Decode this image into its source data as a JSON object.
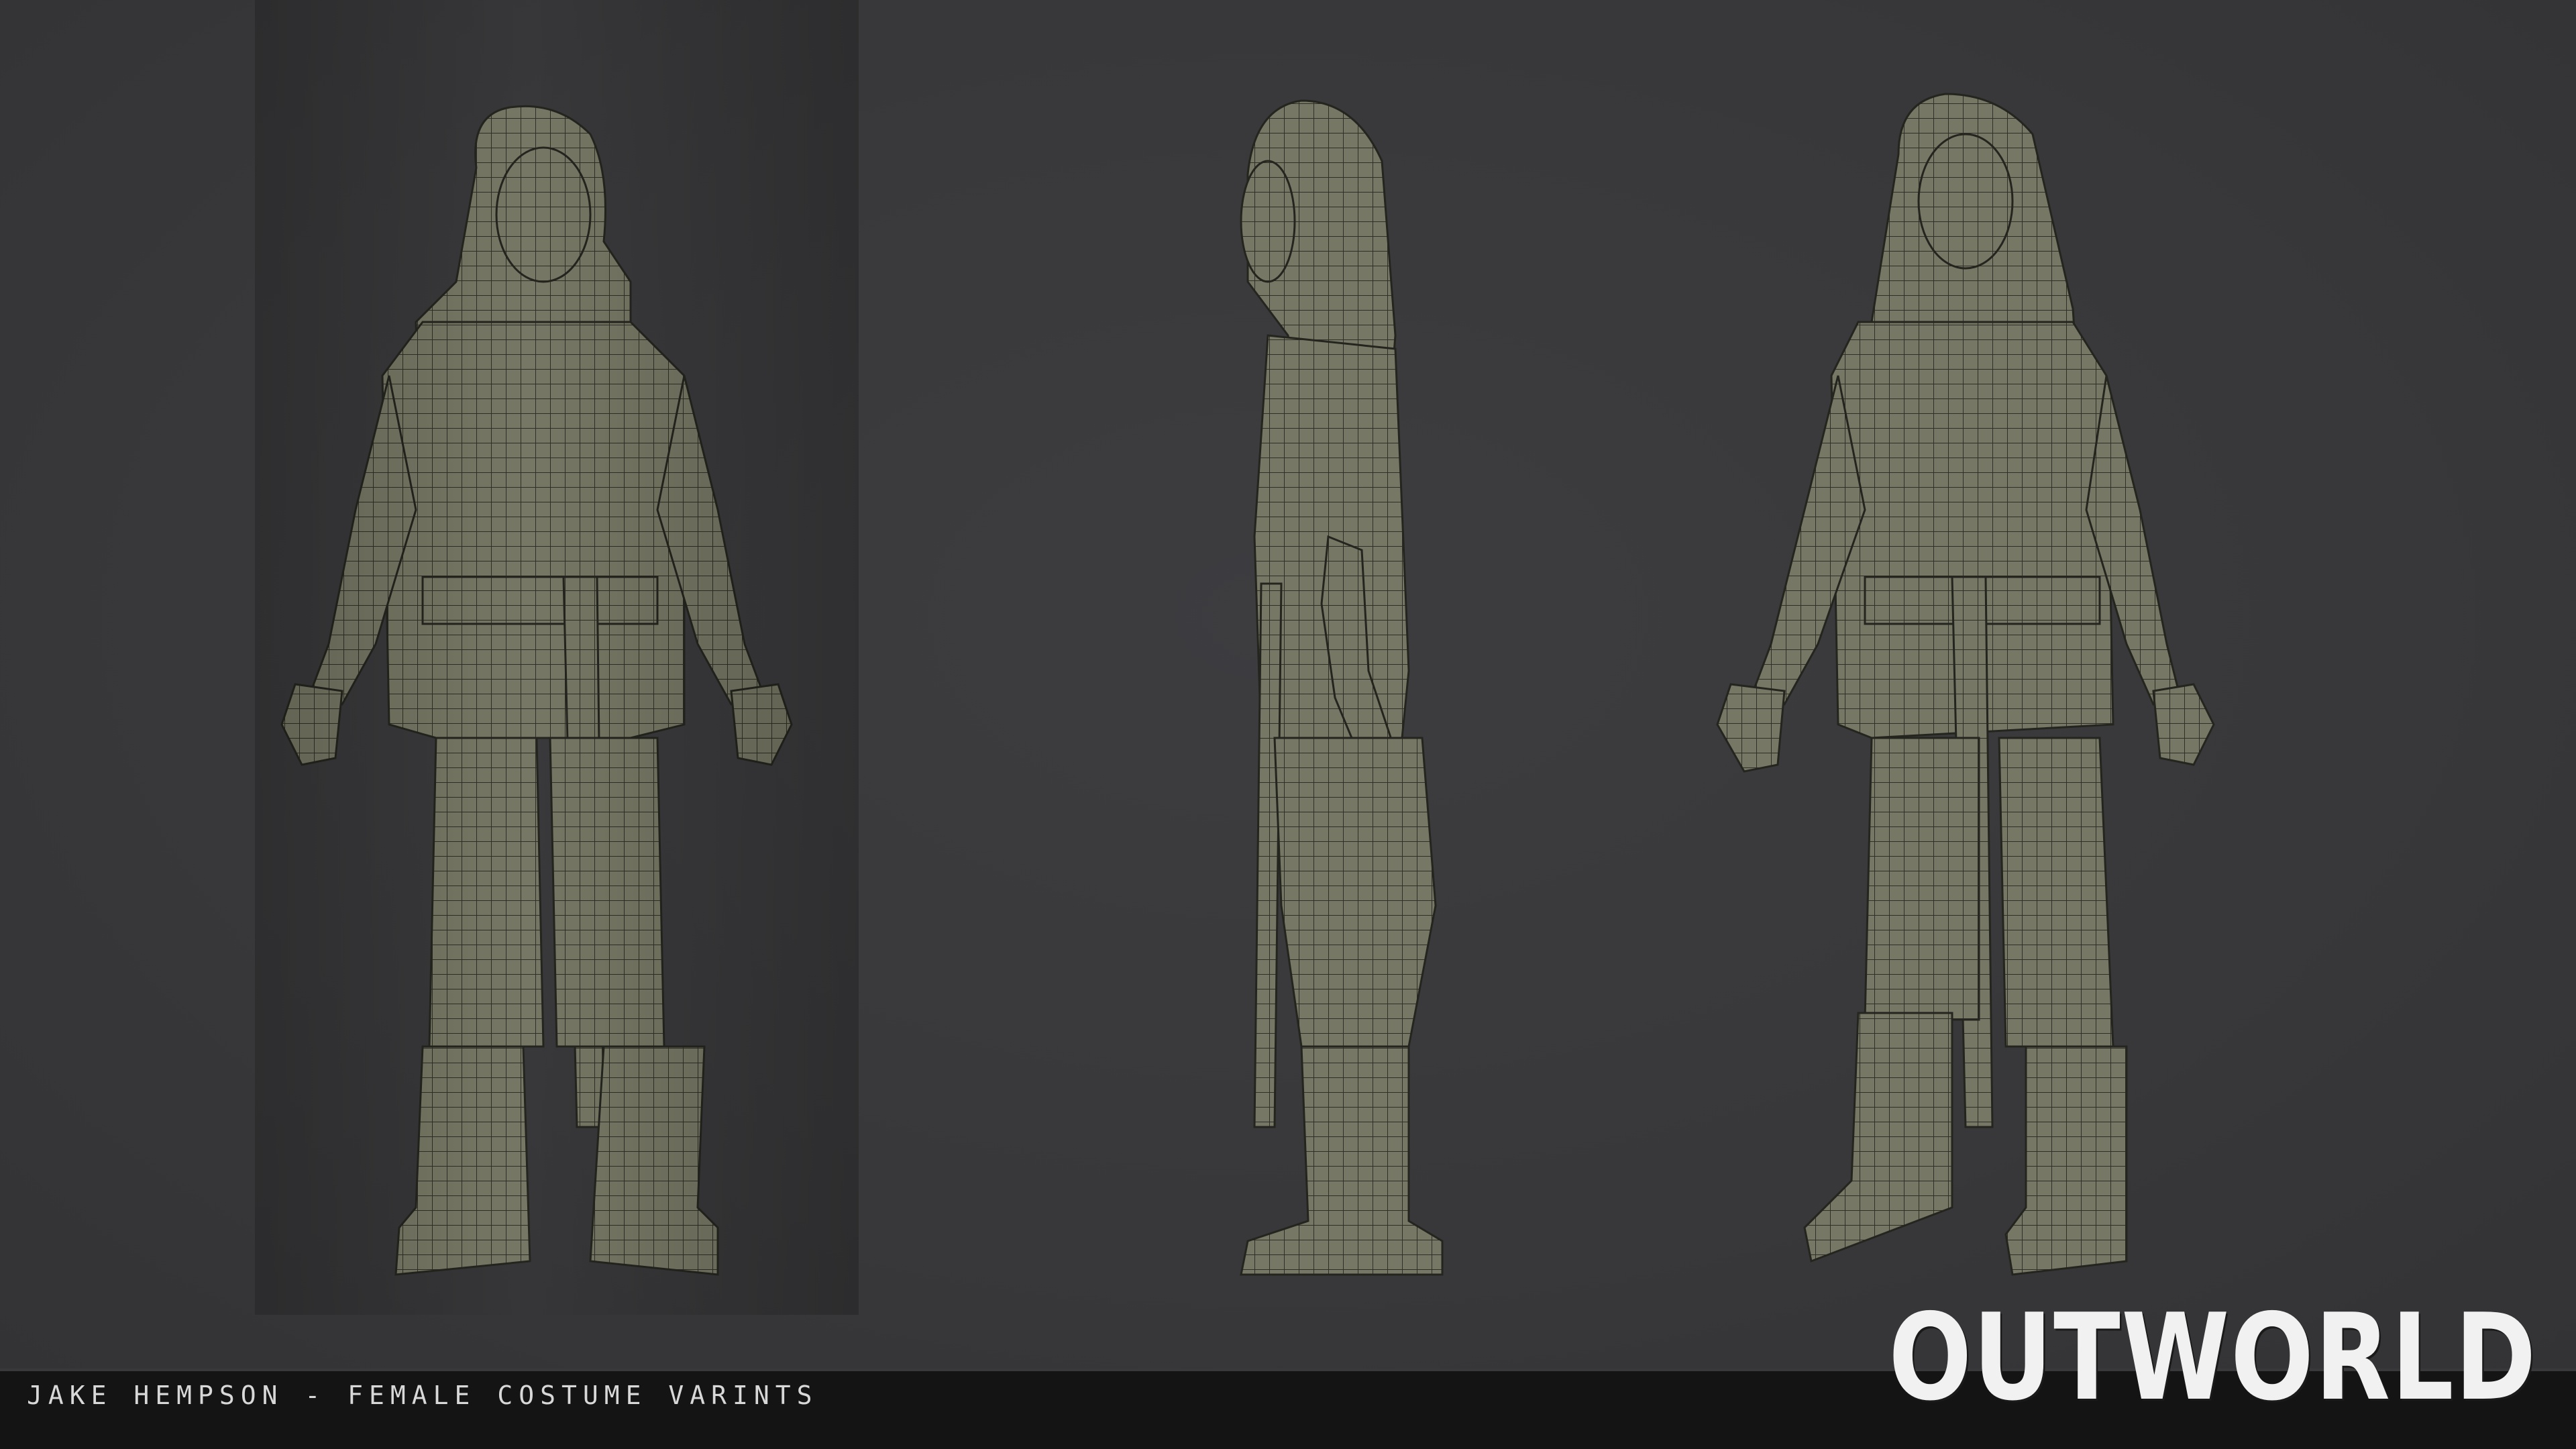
{
  "caption": "JAKE HEMPSON - FEMALE COSTUME VARINTS",
  "logo": "OUTWORLD",
  "colors": {
    "background": "#39393b",
    "model": "#7a7a68",
    "wire": "#2e2e26",
    "caption_bar": "#141414",
    "caption_text": "#d8d8d8",
    "logo_text": "#f1f1f1"
  },
  "views": [
    {
      "name": "front-view"
    },
    {
      "name": "side-view"
    },
    {
      "name": "three-quarter-view"
    }
  ]
}
